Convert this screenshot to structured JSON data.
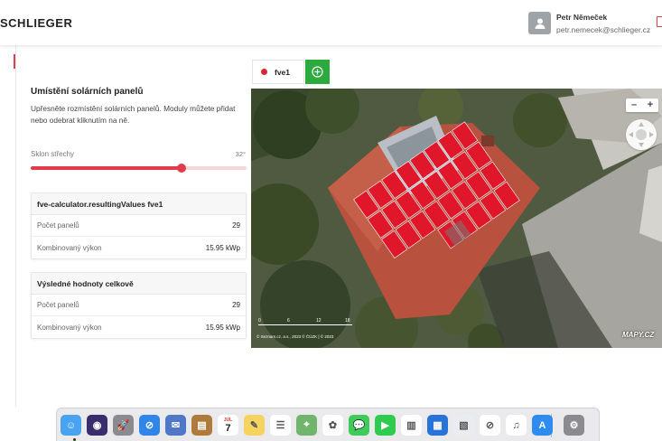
{
  "header": {
    "brand": "SCHLIEGER",
    "user_name": "Petr Němeček",
    "user_email": "petr.nemecek@schlieger.cz"
  },
  "panel": {
    "title": "Umístění solárních panelů",
    "description": "Upřesněte rozmístění solárních panelů. Moduly můžete přidat nebo odebrat kliknutím na ně.",
    "slider_label": "Sklon střechy",
    "slider_value": "32°",
    "slider_fraction": 0.7
  },
  "card1": {
    "title": "fve-calculator.resultingValues fve1",
    "rows": [
      {
        "label": "Počet panelů",
        "value": "29"
      },
      {
        "label": "Kombinovaný výkon",
        "value": "15.95 kWp"
      }
    ]
  },
  "card2": {
    "title": "Výsledné hodnoty celkově",
    "rows": [
      {
        "label": "Počet panelů",
        "value": "29"
      },
      {
        "label": "Kombinovaný výkon",
        "value": "15.95 kWp"
      }
    ]
  },
  "map": {
    "tab_label": "fve1",
    "zoom_out": "–",
    "zoom_in": "+",
    "scale_labels": [
      "0",
      "6",
      "12",
      "18"
    ],
    "copyright": "© Seznam.cz, a.s., 2023 © ČÚZK | © 2023",
    "logo": "MAPY.CZ",
    "panel_color": "#e0162b"
  },
  "accent": "#e23b4a",
  "dock": {
    "apps": [
      "finder-icon",
      "siri-icon",
      "launchpad-icon",
      "safari-icon",
      "mail-icon",
      "contacts-icon",
      "calendar-icon",
      "notes-icon",
      "reminders-icon",
      "maps-icon",
      "photos-icon",
      "messages-icon",
      "facetime-icon",
      "numbers-icon",
      "keynote-icon",
      "preview-icon",
      "news-icon",
      "music-icon",
      "app-store-icon",
      "system-preferences-icon"
    ],
    "calendar_month": "JUL",
    "calendar_day": "7"
  }
}
